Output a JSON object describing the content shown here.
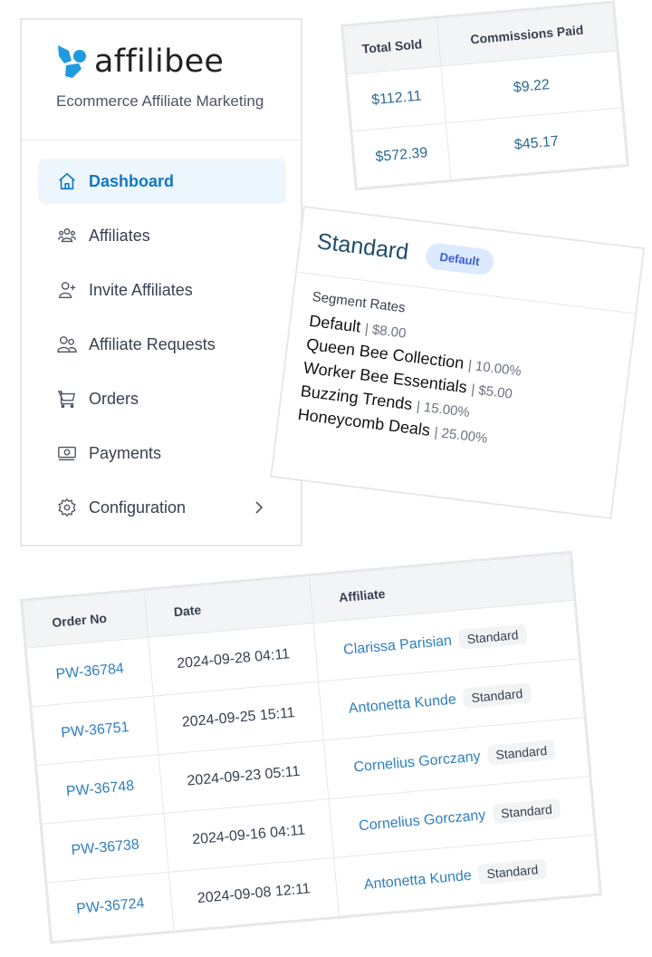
{
  "brand": {
    "name": "affilibee",
    "tagline": "Ecommerce Affiliate Marketing",
    "accent_color": "#1e9be0"
  },
  "sidebar": {
    "items": [
      {
        "label": "Dashboard",
        "icon": "home-icon",
        "active": true
      },
      {
        "label": "Affiliates",
        "icon": "users-group-icon",
        "active": false
      },
      {
        "label": "Invite Affiliates",
        "icon": "user-plus-icon",
        "active": false
      },
      {
        "label": "Affiliate Requests",
        "icon": "users-icon",
        "active": false
      },
      {
        "label": "Orders",
        "icon": "cart-icon",
        "active": false
      },
      {
        "label": "Payments",
        "icon": "cash-icon",
        "active": false
      },
      {
        "label": "Configuration",
        "icon": "gear-icon",
        "active": false,
        "has_submenu": true
      }
    ]
  },
  "stats": {
    "headers": [
      "Total Sold",
      "Commissions Paid"
    ],
    "rows": [
      [
        "$112.11",
        "$9.22"
      ],
      [
        "$572.39",
        "$45.17"
      ]
    ]
  },
  "tier": {
    "title": "Standard",
    "badge": "Default",
    "segment_label": "Segment Rates",
    "segments": [
      {
        "name": "Default",
        "rate": "$8.00"
      },
      {
        "name": "Queen Bee Collection",
        "rate": "10.00%"
      },
      {
        "name": "Worker Bee Essentials",
        "rate": "$5.00"
      },
      {
        "name": "Buzzing Trends",
        "rate": "15.00%"
      },
      {
        "name": "Honeycomb Deals",
        "rate": "25.00%"
      }
    ],
    "separator": "|"
  },
  "orders": {
    "headers": [
      "Order No",
      "Date",
      "Affiliate"
    ],
    "rows": [
      {
        "order": "PW-36784",
        "date": "2024-09-28 04:11",
        "affiliate": "Clarissa Parisian",
        "tier": "Standard"
      },
      {
        "order": "PW-36751",
        "date": "2024-09-25 15:11",
        "affiliate": "Antonetta Kunde",
        "tier": "Standard"
      },
      {
        "order": "PW-36748",
        "date": "2024-09-23 05:11",
        "affiliate": "Cornelius Gorczany",
        "tier": "Standard"
      },
      {
        "order": "PW-36738",
        "date": "2024-09-16 04:11",
        "affiliate": "Cornelius Gorczany",
        "tier": "Standard"
      },
      {
        "order": "PW-36724",
        "date": "2024-09-08 12:11",
        "affiliate": "Antonetta Kunde",
        "tier": "Standard"
      }
    ]
  }
}
